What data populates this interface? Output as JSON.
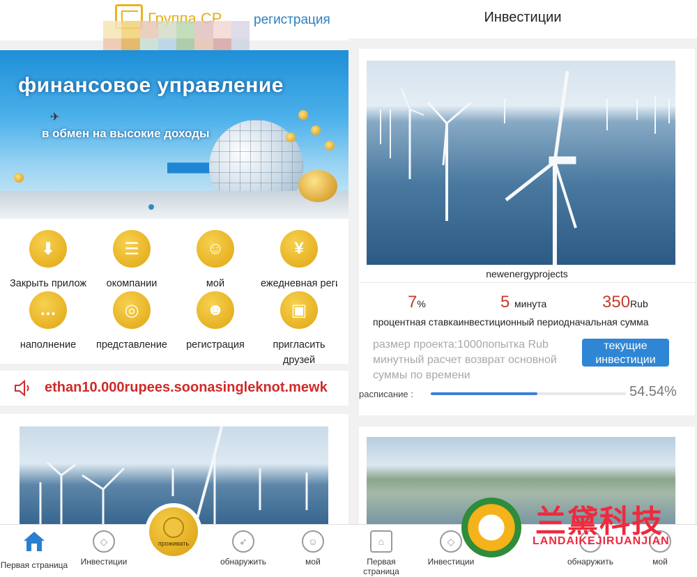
{
  "left": {
    "brand": "Группа CP",
    "register_link": "регистрация",
    "banner": {
      "title": "финансовое управление",
      "subtitle": "в обмен на высокие доходы"
    },
    "grid": [
      {
        "label": "Закрыть приложение",
        "icon": "download-arrow-icon"
      },
      {
        "label": "окомпании",
        "icon": "scroll-icon"
      },
      {
        "label": "мой",
        "icon": "users-icon"
      },
      {
        "label": "ежедневная регистрация",
        "icon": "piggy-bank-icon"
      },
      {
        "label": "наполнение",
        "icon": "chat-icon"
      },
      {
        "label": "представление",
        "icon": "planet-icon"
      },
      {
        "label": "регистрация",
        "icon": "support-agent-icon"
      },
      {
        "label": "пригласить друзей",
        "icon": "wallet-icon"
      }
    ],
    "marquee": "ethan10.000rupees.soonasingleknot.mewk"
  },
  "tabbar": {
    "left": [
      {
        "label": "Первая страница",
        "icon": "home-icon"
      },
      {
        "label": "Инвестиции",
        "icon": "diamond-icon"
      },
      {
        "label": "проживать",
        "icon": "live-face-icon"
      },
      {
        "label": "обнаружить",
        "icon": "compass-icon"
      },
      {
        "label": "мой",
        "icon": "profile-icon"
      }
    ],
    "right": [
      {
        "label": "Первая страница",
        "icon": "home-icon"
      },
      {
        "label": "Инвестиции",
        "icon": "diamond-icon"
      },
      {
        "label": "обнаружить",
        "icon": "compass-icon"
      },
      {
        "label": "мой",
        "icon": "profile-icon"
      }
    ]
  },
  "right": {
    "title": "Инвестиции",
    "project": {
      "name": "newenergyprojects",
      "rate_value": "7",
      "rate_unit": "%",
      "period_value": "5",
      "period_unit": "минута",
      "amount_value": "350",
      "amount_unit": "Rub",
      "labels": "процентная ставкаинвестиционный периодначальная сумма",
      "info": "размер проекта:1000попытка Rub минутный расчет возврат основной суммы по времени",
      "button": "текущие инвестиции",
      "schedule_label": "расписание :",
      "progress_text": "54.54%",
      "progress": 0.5454
    }
  },
  "watermark": {
    "cn": "兰黛科技",
    "en": "LANDAIKEJIRUANJIAN"
  },
  "colors": {
    "accent_gold": "#e0a512",
    "link_blue": "#2d7fc0",
    "marquee_red": "#d02a2a",
    "stat_red": "#c63b2a",
    "button_blue": "#2f86d4"
  }
}
